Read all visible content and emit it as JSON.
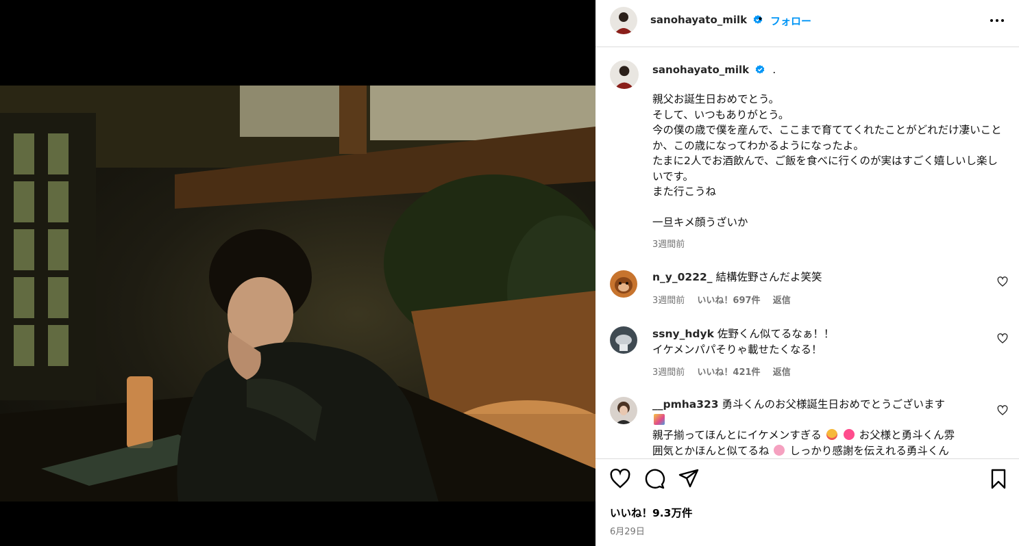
{
  "post": {
    "username": "sanohayato_milk",
    "follow_label": "フォロー",
    "separator": "•",
    "caption_suffix": ".",
    "caption": "親父お誕生日おめでとう。\nそして、いつもありがとう。\n今の僕の歳で僕を産んで、ここまで育ててくれたことがどれだけ凄いことか、この歳になってわかるようになったよ。\nたまに2人でお酒飲んで、ご飯を食べに行くのが実はすごく嬉しいし楽しいです。\nまた行こうね\n\n一旦キメ顔うざいか",
    "caption_time": "3週間前",
    "likes": "いいね！9.3万件",
    "date": "6月29日"
  },
  "comments": [
    {
      "user": "n_y_0222_",
      "text": "結構佐野さんだよ笑笑",
      "time": "3週間前",
      "likes": "いいね！697件",
      "reply": "返信"
    },
    {
      "user": "ssny_hdyk",
      "text": "佐野くん似てるなぁ！！\nイケメンパパそりゃ載せたくなる！",
      "time": "3週間前",
      "likes": "いいね！421件",
      "reply": "返信"
    },
    {
      "user": "__pmha323",
      "text_a": "勇斗くんのお父様誕生日おめでとうございます",
      "text_b": "親子揃ってほんとにイケメンすぎる",
      "text_c": "お父様と勇斗くん雰",
      "text_d": "囲気とかほんと似てるね",
      "text_e": "しっかり感謝を伝えれる勇斗くん"
    }
  ],
  "icons": {
    "more": "more-options-icon",
    "verified": "verified-badge-icon",
    "like": "heart-icon",
    "comment": "comment-icon",
    "share": "share-icon",
    "save": "bookmark-icon"
  },
  "colors": {
    "accent": "#0095f6",
    "verified": "#0095f6",
    "muted": "#737373"
  }
}
